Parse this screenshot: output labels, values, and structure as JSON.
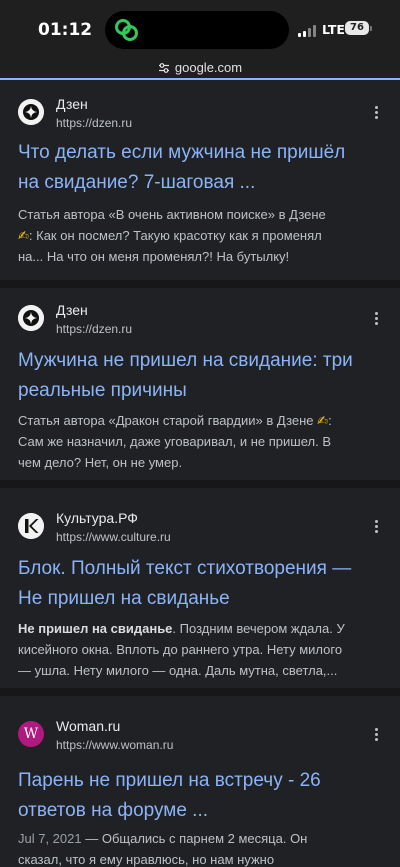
{
  "status": {
    "time": "01:12",
    "network": "LTE",
    "battery": "76"
  },
  "browser": {
    "url": "google.com"
  },
  "results": [
    {
      "site_name": "Дзен",
      "url": "https://dzen.ru",
      "title_line1": "Что делать если мужчина не пришёл",
      "title_line2": "на свидание? 7-шаговая ...",
      "snippet_line1": "Статья автора «В очень активном поиске» в Дзене",
      "snippet_emoji": "✍",
      "snippet_line2_rest": ": Как он посмел? Такую красотку как я променял",
      "snippet_line3": "на... На что он меня променял?! На бутылку!"
    },
    {
      "site_name": "Дзен",
      "url": "https://dzen.ru",
      "title_line1": "Мужчина не пришел на свидание: три",
      "title_line2": "реальные причины",
      "snippet_line1_text": "Статья автора «Дракон старой гвардии» в Дзене",
      "snippet_emoji": "✍",
      "snippet_line1_end": ":",
      "snippet_line2": "Сам же назначил, даже уговаривал, и не пришел. В",
      "snippet_line3": "чем дело? Нет, он не умер."
    },
    {
      "site_name": "Культура.РФ",
      "url": "https://www.culture.ru",
      "title_line1": "Блок. Полный текст стихотворения —",
      "title_line2": "Не пришел на свиданье",
      "snippet_bold": "Не пришел на свиданье",
      "snippet_line1_rest": ". Поздним вечером ждала. У",
      "snippet_line2": "кисейного окна. Вплоть до раннего утра. Нету милого",
      "snippet_line3": "— ушла. Нету милого — одна. Даль мутна, светла,..."
    },
    {
      "site_name": "Woman.ru",
      "favicon_letter": "W",
      "url": "https://www.woman.ru",
      "title_line1": "Парень не пришел на встречу - 26",
      "title_line2": "ответов на форуме ...",
      "snippet_date": "Jul 7, 2021",
      "snippet_line1_rest": " — Общались с парнем 2 месяца. Он",
      "snippet_line2": "сказал, что я ему нравлюсь, но нам нужно"
    }
  ],
  "colors": {
    "link": "#8ab4f8",
    "background": "#202124",
    "separator": "#171717",
    "woman_favicon": "#b0197e"
  },
  "icons": [
    "island-link-icon",
    "signal-icon",
    "battery-icon",
    "site-settings-icon",
    "dzen-logo-icon",
    "kultura-logo-icon",
    "more-vert-icon"
  ]
}
